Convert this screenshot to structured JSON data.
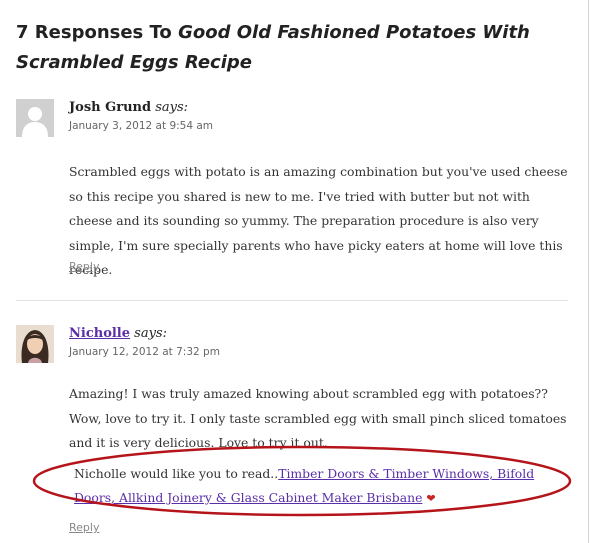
{
  "heading": {
    "prefix": "7 Responses To ",
    "title": "Good Old Fashioned Potatoes With Scrambled Eggs Recipe"
  },
  "comments": [
    {
      "author": "Josh Grund",
      "says": "says:",
      "date": "January 3, 2012 at 9:54 am",
      "text": "Scrambled eggs with potato is an amazing combination but you've used cheese so this recipe you shared is new to me. I've tried with butter but not with cheese and its sounding so yummy. The preparation procedure is also very simple, I'm sure specially parents who have picky eaters at home will love this recipe.",
      "reply": "Reply"
    },
    {
      "author": "Nicholle",
      "says": "says:",
      "date": "January 12, 2012 at 7:32 pm",
      "text": "Amazing! I was truly amazed knowing about scrambled egg with potatoes?? Wow, love to try it. I only taste scrambled egg with small pinch sliced tomatoes and it is very delicious. Love to try it out.",
      "promo_prefix": "Nicholle would like you to read..",
      "promo_link": "Timber Doors & Timber Windows, Bifold Doors, Allkind Joinery & Glass Cabinet Maker Brisbane",
      "promo_icon": "comment-luv-heart-icon",
      "reply": "Reply"
    }
  ],
  "colors": {
    "link": "#5a2ea6",
    "highlight_ellipse": "#b5141b",
    "divider": "#e2e2e2"
  }
}
